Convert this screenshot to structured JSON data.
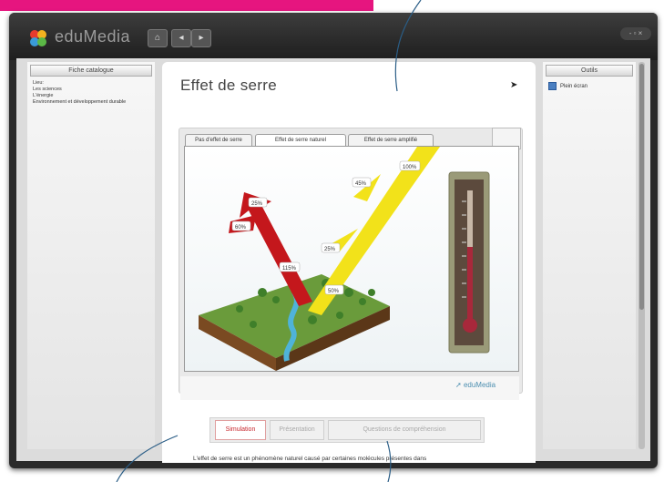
{
  "app": {
    "brand": "eduMedia",
    "nav_buttons": [
      "⌂",
      "◂",
      "▸"
    ],
    "window_controls": "- ▫ ×"
  },
  "left_panel": {
    "title": "Fiche catalogue",
    "items": [
      "Lieu:",
      "Les sciences",
      "L'énergie",
      "Environnement et développement durable"
    ]
  },
  "right_panel": {
    "title": "Outils",
    "items": [
      {
        "label": "Plein écran",
        "icon": "fullscreen-icon"
      }
    ]
  },
  "page": {
    "title": "Effet de serre"
  },
  "simulation": {
    "tabs": [
      "Pas d'effet de serre",
      "Effet de serre naturel",
      "Effet de serre amplifié"
    ],
    "active_tab": 1,
    "labels": {
      "incoming": "100%",
      "reflected": "45%",
      "absorbed": "25%",
      "ground": "50%",
      "ir_out": "115%",
      "emitted": "60%",
      "escape": "25%"
    },
    "link": "eduMedia"
  },
  "bottom_tabs": [
    "Simulation",
    "Présentation",
    "Questions de compréhension"
  ],
  "active_bottom_tab": 0,
  "body_text": "L'effet de serre est un phénomène naturel causé par certaines molécules présentes dans",
  "colors": {
    "accent": "#e6157f",
    "ir_arrow": "#c4171c",
    "sun_arrow": "#f2e21a",
    "link": "#4d8fb0"
  }
}
